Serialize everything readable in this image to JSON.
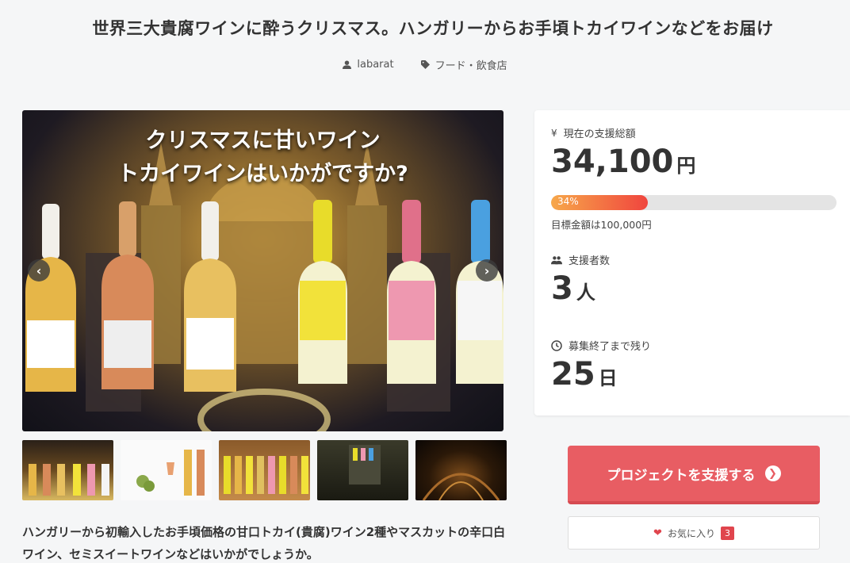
{
  "project": {
    "title": "世界三大貴腐ワインに酔うクリスマス。ハンガリーからお手頃トカイワインなどをお届け",
    "owner": "labarat",
    "category": "フード・飲食店"
  },
  "hero": {
    "caption_line1": "クリスマスに甘いワイン",
    "caption_line2": "トカイワインはいかがですか?",
    "prev_icon": "‹",
    "next_icon": "›"
  },
  "description": "ハンガリーから初輸入したお手頃価格の甘口トカイ(貴腐)ワイン2種やマスカットの辛口白ワイン、セミスイートワインなどはいかがでしょうか。",
  "stats": {
    "funding_label": "現在の支援総額",
    "funding_value": "34,100",
    "funding_unit": "円",
    "progress_percent": 34,
    "progress_label": "34%",
    "goal_text": "目標金額は100,000円",
    "backers_label": "支援者数",
    "backers_value": "3",
    "backers_unit": "人",
    "remaining_label": "募集終了まで残り",
    "remaining_value": "25",
    "remaining_unit": "日"
  },
  "actions": {
    "support_label": "プロジェクトを支援する",
    "favorite_label": "お気に入り",
    "favorite_count": "3"
  },
  "colors": {
    "accent": "#e85d63",
    "progress_start": "#f7a84a",
    "progress_end": "#f0453e"
  }
}
